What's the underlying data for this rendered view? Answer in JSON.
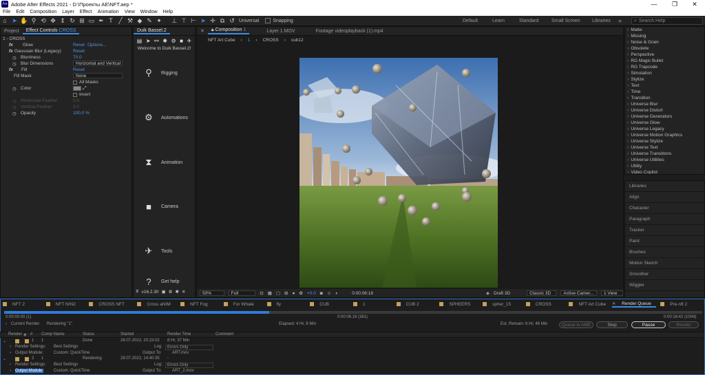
{
  "titlebar": {
    "app_icon": "Ae",
    "title": "Adobe After Effects 2021 - D:\\Проекты AE\\NFT.aep *"
  },
  "window_controls": {
    "minimize": "—",
    "maximize": "❐",
    "close": "✕"
  },
  "menu": [
    "File",
    "Edit",
    "Composition",
    "Layer",
    "Effect",
    "Animation",
    "View",
    "Window",
    "Help"
  ],
  "toolbar": {
    "universal": "Universal",
    "snapping": "Snapping",
    "workspaces": [
      "Default",
      "Learn",
      "Standard",
      "Small Screen",
      "Libraries"
    ],
    "search_placeholder": "Search Help"
  },
  "left_panel": {
    "tab_project": "Project",
    "tab_effect_controls": "Effect Controls",
    "tab_effect_target": "CROSS",
    "layer_title": "1 - CROSS",
    "glow": {
      "name": "Glow",
      "reset": "Reset",
      "options": "Options..."
    },
    "blur": {
      "name": "Gaussian Blur (Legacy)",
      "reset": "Reset",
      "blurriness_label": "Blurriness",
      "blurriness_value": "70.0",
      "dimensions_label": "Blur Dimensions",
      "dimensions_value": "Horizontal and Vertical"
    },
    "fill": {
      "name": "Fill",
      "reset": "Reset",
      "mask_label": "Fill Mask",
      "mask_value": "None",
      "all_masks": "All Masks",
      "color_label": "Color",
      "invert": "Invert",
      "hfeather_label": "Horizontal Feather",
      "hfeather_value": "0.0",
      "vfeather_label": "Vertical Feather",
      "vfeather_value": "0.0",
      "opacity_label": "Opacity",
      "opacity_value": "100.0 %"
    }
  },
  "duik": {
    "tab": "Duik Bassel.2",
    "welcome": "Welcome to Duik Bassel.2!",
    "items": [
      "Rigging",
      "Automations",
      "Animation",
      "Camera",
      "Tools",
      "Get help"
    ],
    "version": "v16.2.30"
  },
  "viewer": {
    "tabs": {
      "composition": "Composition",
      "comp_name": "1",
      "layer": "Layer 1.MOV",
      "footage": "Footage videoplayback (1).mp4"
    },
    "breadcrumbs": [
      "NFT Art Cube",
      "1",
      "CROSS",
      "cub12"
    ],
    "bottom": {
      "zoom": "50%",
      "resolution": "Full",
      "exposure": "+0.0",
      "timecode": "0:00:06:18",
      "renderer": "Draft 3D",
      "view_mode": "Classic 3D",
      "camera": "Active Camer...",
      "views": "1 View"
    }
  },
  "effects_list": [
    "Matte",
    "Missing",
    "Noise & Grain",
    "Obsolete",
    "Perspective",
    "RG Magic Bullet",
    "RG Trapcode",
    "Simulation",
    "Stylize",
    "Text",
    "Time",
    "Transition",
    "Universe Blur",
    "Universe Distort",
    "Universe Generators",
    "Universe Glow",
    "Universe Legacy",
    "Universe Motion Graphics",
    "Universe Stylize",
    "Universe Text",
    "Universe Transitions",
    "Universe Utilities",
    "Utility",
    "Video Copilot"
  ],
  "right_panels": [
    "Libraries",
    "Align",
    "Character",
    "Paragraph",
    "Tracker",
    "Paint",
    "Brushes",
    "Motion Sketch",
    "Smoother",
    "Wiggler"
  ],
  "timeline_tabs": [
    "NFT 2",
    "NFT NIN2",
    "CROSS NFT",
    "Cross aNIM",
    "NFT Fog",
    "For Whale",
    "fly",
    "CUB",
    "1",
    "CUB 2",
    "SPHEERS",
    "spher_15",
    "CROSS",
    "NFT Art Cube",
    "Render Queue",
    "Pre-nft 2"
  ],
  "render_queue": {
    "progress": 0.38,
    "time_start": "0:00:00:00 (1)",
    "time_current": "0:00:06:19 (381)",
    "time_end": "0:00:16:42 (1004)",
    "current_render_label": "Current Render",
    "rendering_label": "Rendering \"1\"",
    "elapsed": "Elapsed: 4 Hr, 8 Min",
    "remain": "Est. Remain: 6 Hr, 48 Min",
    "queue_ame": "Queue in AME",
    "stop": "Stop",
    "pause": "Pause",
    "render": "Render",
    "columns": [
      "Render",
      "#",
      "Comp Name",
      "Status",
      "Started",
      "Render Time",
      "Comment"
    ],
    "items": [
      {
        "num": "1",
        "comp": "1",
        "status": "Done",
        "started": "28.07.2022, 20:23:02",
        "time": "8 Hr, 37 Min",
        "settings_label": "Render Settings:",
        "settings": "Best Settings",
        "log_label": "Log:",
        "log": "Errors Only",
        "module_label": "Output Module:",
        "module": "Custom: QuickTime",
        "output_label": "Output To:",
        "output": "ART.mov"
      },
      {
        "num": "2",
        "comp": "1",
        "status": "Rendering",
        "started": "29.07.2022, 14:40:35",
        "time": "-",
        "settings_label": "Render Settings:",
        "settings": "Best Settings",
        "log_label": "Log:",
        "log": "Errors Only",
        "module_label": "Output Module:",
        "module": "Custom: QuickTime",
        "output_label": "Output To:",
        "output": "ART_2.mov"
      }
    ]
  },
  "colors": {
    "accent": "#3b8ae6",
    "progress": "#2f7bd9",
    "label_yellow": "#c5a15c"
  }
}
